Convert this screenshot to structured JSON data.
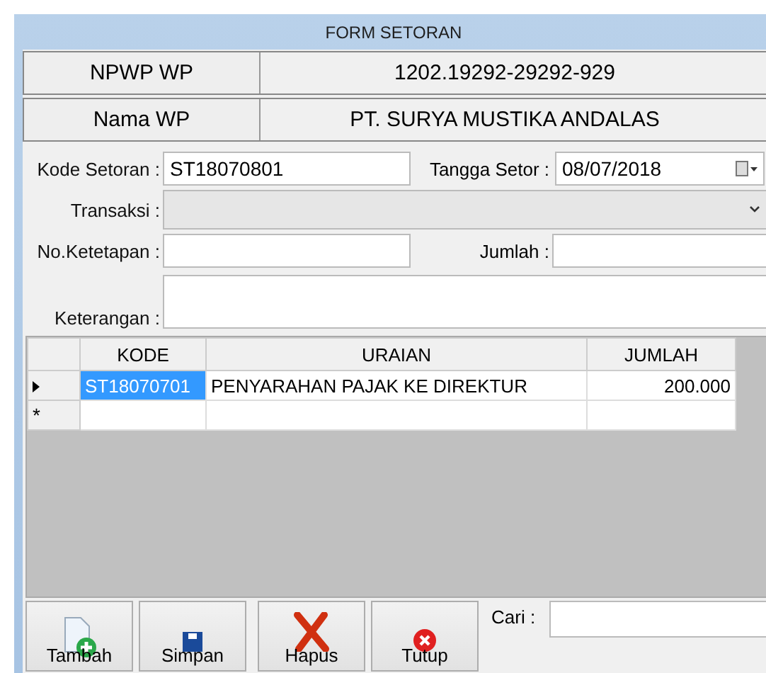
{
  "window": {
    "title": "FORM SETORAN"
  },
  "header_rows": [
    {
      "label": "NPWP WP",
      "value": "1202.19292-29292-929"
    },
    {
      "label": "Nama  WP",
      "value": "PT. SURYA MUSTIKA ANDALAS"
    }
  ],
  "kode_setoran": {
    "label": "Kode Setoran :",
    "value": "ST18070801"
  },
  "tanggal_setor": {
    "label": "Tangga Setor :",
    "value": "08/07/2018"
  },
  "transaksi": {
    "label": "Transaksi :"
  },
  "no_ketetapan": {
    "label": "No.Ketetapan :"
  },
  "jumlah": {
    "label": "Jumlah :"
  },
  "keterangan": {
    "label": "Keterangan :"
  },
  "grid": {
    "columns": [
      "KODE",
      "URAIAN",
      "JUMLAH"
    ],
    "rows": [
      {
        "cells": [
          "ST18070701",
          "PENYARAHAN PAJAK KE DIREKTUR",
          "200.000"
        ],
        "selected": true
      }
    ],
    "new_row_marker": "*"
  },
  "buttons": [
    {
      "label": "Tambah",
      "kind": "add"
    },
    {
      "label": "Simpan",
      "kind": "save"
    },
    {
      "label": "Hapus",
      "kind": "delete"
    },
    {
      "label": "Tutup",
      "kind": "close"
    }
  ],
  "search": {
    "label": "Cari :"
  }
}
